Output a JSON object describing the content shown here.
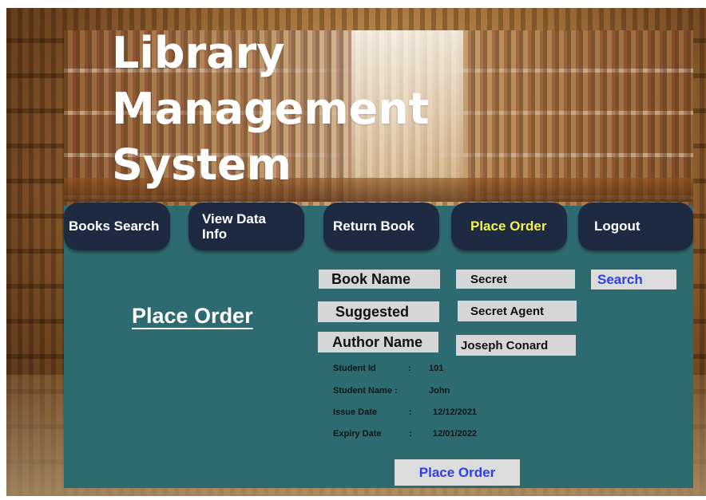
{
  "app": {
    "title_lines": [
      "Library",
      "Management",
      "System"
    ]
  },
  "nav": {
    "books_search": "Books Search",
    "view_data_info": "View Data\nInfo",
    "return_book": "Return Book",
    "place_order": "Place Order",
    "logout": "Logout"
  },
  "page": {
    "title": "Place Order"
  },
  "form": {
    "book_name_label": "Book Name",
    "book_name_value": "Secret",
    "suggested_label": "Suggested",
    "suggested_value": "Secret Agent",
    "author_name_label": "Author Name",
    "author_name_value": "Joseph Conard",
    "search_button": "Search"
  },
  "details": {
    "student_id_label": "Student  Id",
    "student_id_sep": ":",
    "student_id_value": "101",
    "student_name_label": "Student Name :",
    "student_name_value": "John",
    "issue_date_label": "Issue Date",
    "issue_date_sep": ":",
    "issue_date_value": "12/12/2021",
    "expiry_date_label": "Expiry Date",
    "expiry_date_sep": ":",
    "expiry_date_value": "12/01/2022"
  },
  "actions": {
    "place_order_button": "Place Order"
  },
  "colors": {
    "panel": "#2e6b71",
    "nav_button": "#1e2a41",
    "nav_active_text": "#f3f34a",
    "action_text": "#2d3df0",
    "field_bg": "#d6d6d6"
  }
}
